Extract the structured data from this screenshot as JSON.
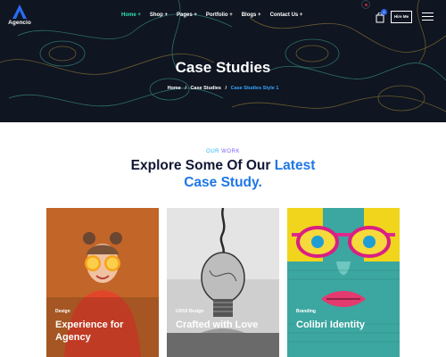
{
  "brand": {
    "name": "Agencio",
    "accent": "#1e77e6"
  },
  "nav": {
    "items": [
      {
        "label": "Home +",
        "active": true
      },
      {
        "label": "Shop +",
        "active": false
      },
      {
        "label": "Pages +",
        "active": false
      },
      {
        "label": "Portfolio +",
        "active": false
      },
      {
        "label": "Blogs +",
        "active": false
      },
      {
        "label": "Contact Us +",
        "active": false
      }
    ],
    "cart_count": "0",
    "hire_label": "Hire Me"
  },
  "hero": {
    "title": "Case Studies",
    "breadcrumb": [
      "Home",
      "Case Studies",
      "Case Studies Style 1"
    ],
    "breadcrumb_separator": "/"
  },
  "section": {
    "eyebrow_part1": "OUR",
    "eyebrow_part2": "WORK",
    "heading_plain": "Explore Some Of Our ",
    "heading_highlight_1": "Latest",
    "heading_highlight_2": "Case Study."
  },
  "cards": [
    {
      "category": "Design",
      "title": "Experience for Agency"
    },
    {
      "category": "UX/UI Design",
      "title": "Crafted with Love"
    },
    {
      "category": "Branding",
      "title": "Colibri Identity"
    }
  ]
}
